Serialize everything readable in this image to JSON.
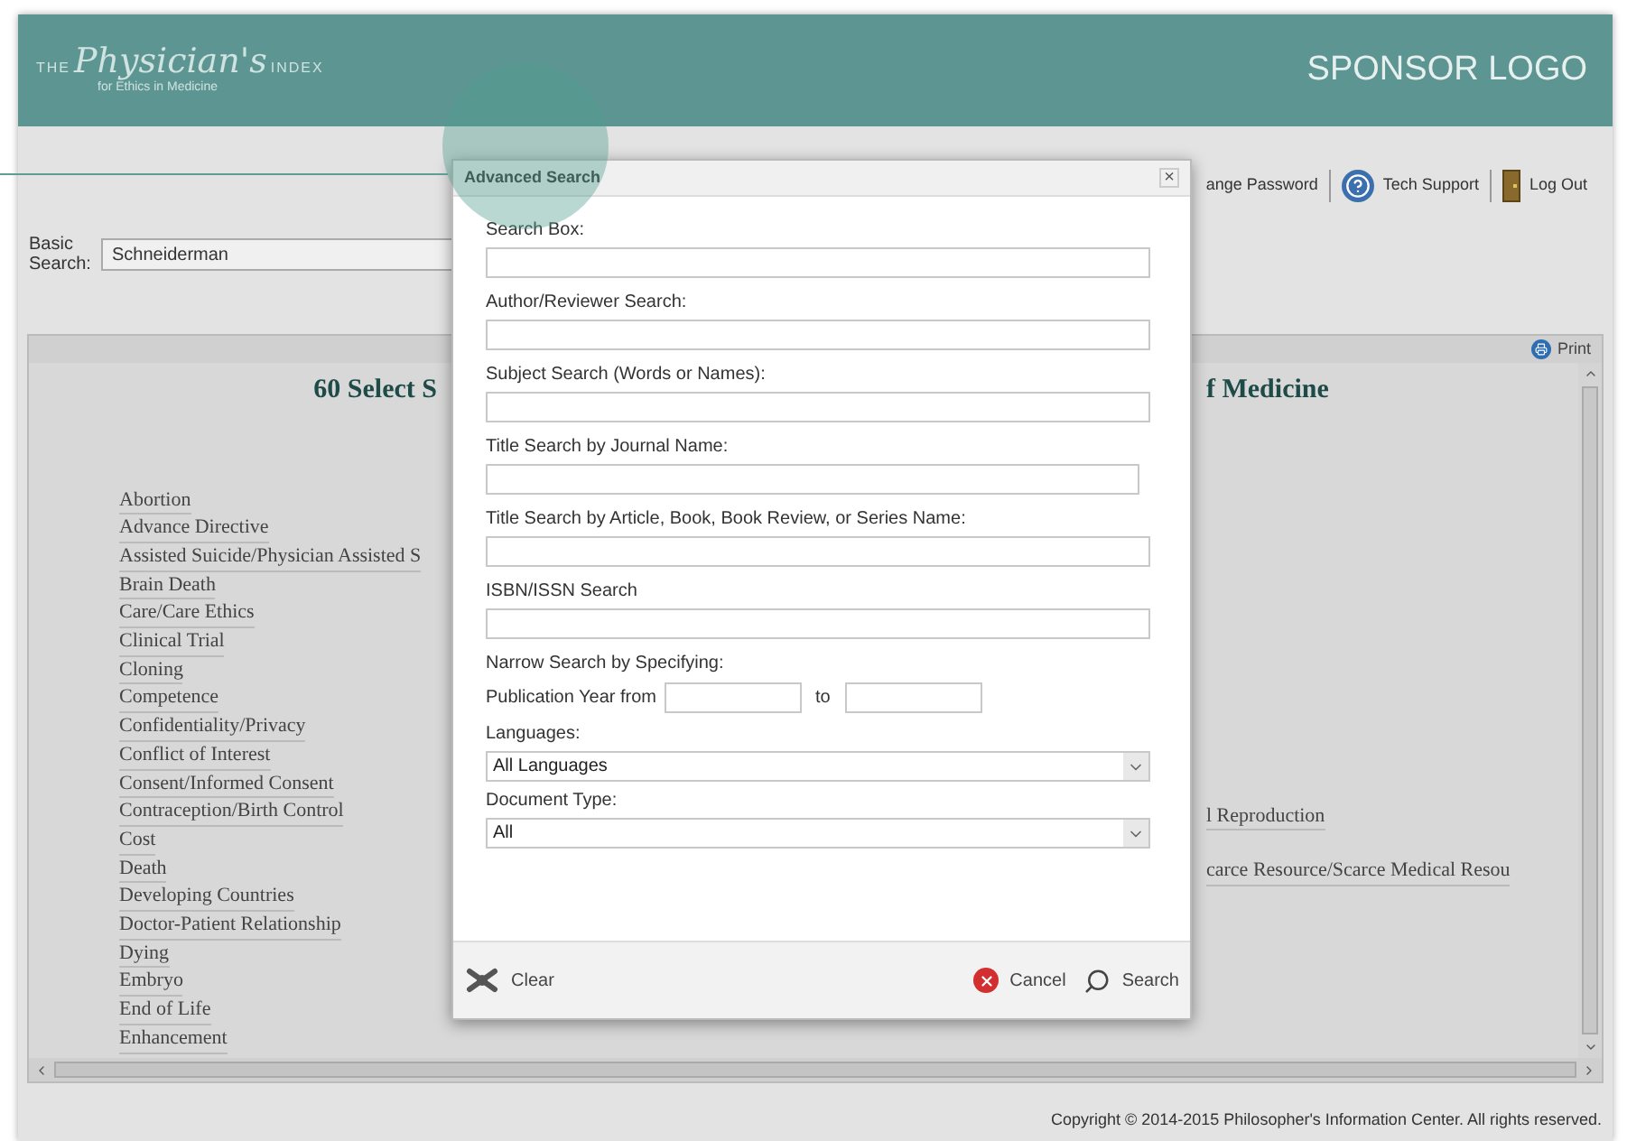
{
  "header": {
    "logo": {
      "the": "THE",
      "name": "Physician's",
      "index": "INDEX",
      "tagline": "for Ethics in Medicine"
    },
    "sponsor": "SPONSOR LOGO"
  },
  "top_links": [
    {
      "label": "ange Password"
    },
    {
      "label": "Tech Support"
    },
    {
      "label": "Log Out"
    }
  ],
  "basic_search": {
    "label": "Basic Search:",
    "value": "Schneiderman"
  },
  "toolbar": {
    "print": "Print"
  },
  "content": {
    "heading_left": "60 Select S",
    "heading_right": "f Medicine",
    "items_left": [
      "Abortion",
      "Advance Directive",
      "Assisted Suicide/Physician Assisted S",
      "Brain Death",
      "Care/Care Ethics",
      "Clinical Trial",
      "Cloning",
      "Competence",
      "Confidentiality/Privacy",
      "Conflict of Interest",
      "Consent/Informed Consent",
      "Contraception/Birth Control",
      "Cost",
      "Death",
      "Developing Countries",
      "Doctor-Patient Relationship",
      "Dying",
      "Embryo",
      "End of Life",
      "Enhancement"
    ],
    "items_right": [
      "l Reproduction",
      "carce Resource/Scarce Medical Resou"
    ]
  },
  "footer": {
    "copyright": "Copyright © 2014-2015 Philosopher's Information Center. All rights reserved."
  },
  "dialog": {
    "title": "Advanced Search",
    "close": "×",
    "fields": [
      {
        "kind": "text",
        "label": "Search Box:"
      },
      {
        "kind": "text",
        "label": "Author/Reviewer Search:"
      },
      {
        "kind": "text",
        "label": "Subject Search (Words or Names):"
      },
      {
        "kind": "text",
        "label": "Title Search by Journal Name:"
      },
      {
        "kind": "text",
        "label": "Title Search by Article, Book, Book Review, or Series Name:"
      },
      {
        "kind": "text",
        "label": "ISBN/ISSN Search"
      },
      {
        "kind": "heading",
        "label": "Narrow Search by Specifying:"
      },
      {
        "kind": "range",
        "label": "Publication Year from",
        "separator": "to"
      },
      {
        "kind": "select",
        "label": "Languages:",
        "value": "All Languages"
      },
      {
        "kind": "select",
        "label": "Document Type:",
        "value": "All"
      }
    ],
    "buttons": [
      {
        "kind": "clear",
        "label": "Clear"
      },
      {
        "kind": "cancel",
        "label": "Cancel"
      },
      {
        "kind": "search",
        "label": "Search"
      }
    ]
  }
}
